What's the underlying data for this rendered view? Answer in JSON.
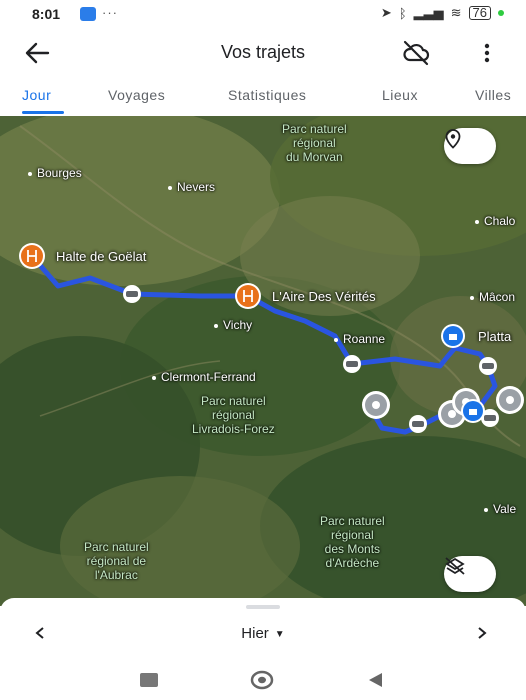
{
  "status": {
    "time": "8:01",
    "dots": "···",
    "battery": "76"
  },
  "header": {
    "title": "Vos trajets"
  },
  "tabs": [
    {
      "label": "Jour"
    },
    {
      "label": "Voyages"
    },
    {
      "label": "Statistiques"
    },
    {
      "label": "Lieux"
    },
    {
      "label": "Villes"
    }
  ],
  "map": {
    "parks": [
      {
        "line1": "Parc naturel",
        "line2": "régional",
        "line3": "du Morvan"
      },
      {
        "line1": "Parc naturel",
        "line2": "régional",
        "line3": "Livradois-Forez"
      },
      {
        "line1": "Parc naturel",
        "line2": "régional",
        "line3": "des Monts",
        "line4": "d'Ardèche"
      },
      {
        "line1": "Parc naturel",
        "line2": "régional de",
        "line3": "l'Aubrac"
      }
    ],
    "cities": {
      "bourges": "Bourges",
      "nevers": "Nevers",
      "vichy": "Vichy",
      "roanne": "Roanne",
      "clermont": "Clermont-Ferrand",
      "chalon": "Chalo",
      "macon": "Mâcon",
      "valence": "Vale"
    },
    "places": {
      "halte": "Halte de Goëlat",
      "aire": "L'Aire Des Vérités",
      "platta": "Platta"
    }
  },
  "sheet": {
    "date_label": "Hier"
  }
}
